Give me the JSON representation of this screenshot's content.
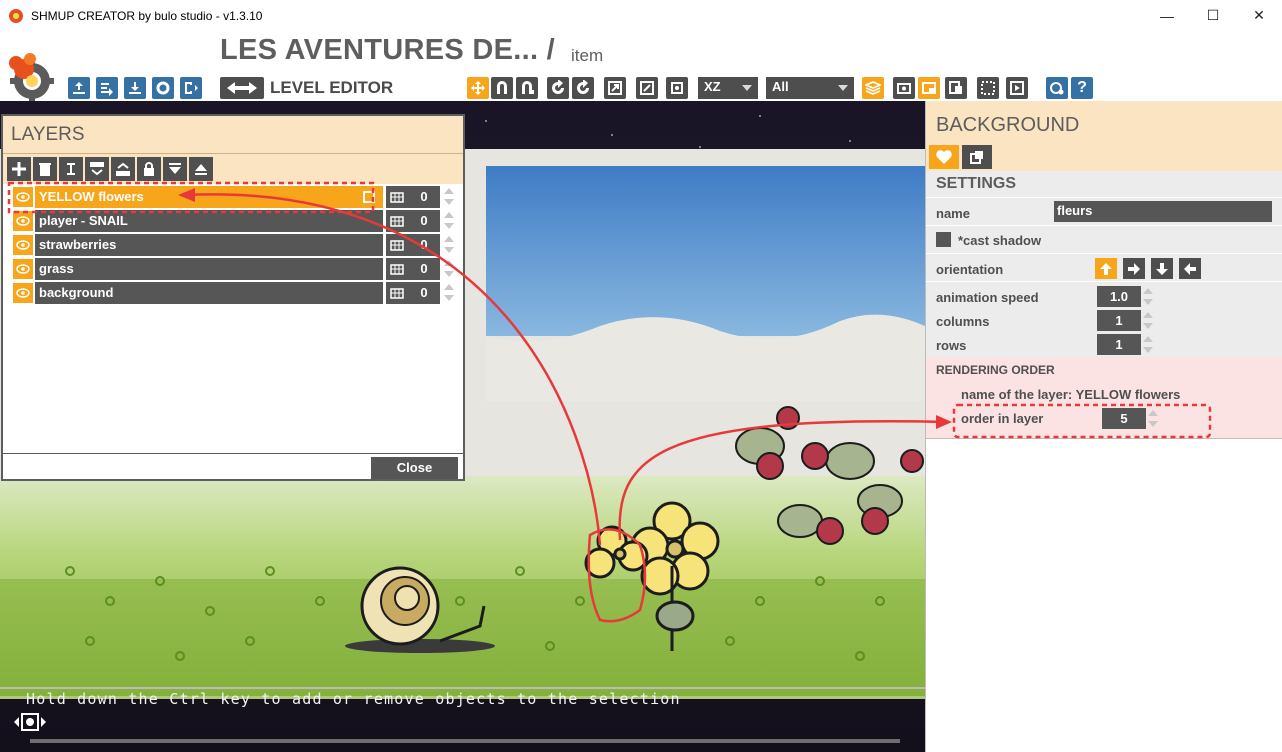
{
  "window": {
    "title": "SHMUP CREATOR by bulo studio - v1.3.10",
    "controls": [
      "minimize-icon",
      "maximize-icon",
      "close-icon"
    ]
  },
  "header": {
    "project_title": "LES AVENTURES DE... /",
    "subtitle": "item",
    "mode_label": "LEVEL EDITOR",
    "axis_select": "XZ",
    "filter_select": "All"
  },
  "scene": {
    "hint": "Hold down the Ctrl key to add or remove objects to the selection"
  },
  "layers_panel": {
    "title": "LAYERS",
    "tools": [
      "add-icon",
      "trash-icon",
      "rename-icon",
      "merge-down-icon",
      "merge-up-icon",
      "lock-icon",
      "move-down-icon",
      "move-up-icon"
    ],
    "layers": [
      {
        "name": "YELLOW flowers",
        "value": "0",
        "active": true
      },
      {
        "name": "player - SNAIL",
        "value": "0",
        "active": false
      },
      {
        "name": "strawberries",
        "value": "0",
        "active": false
      },
      {
        "name": "grass",
        "value": "0",
        "active": false
      },
      {
        "name": "background",
        "value": "0",
        "active": false
      }
    ],
    "close_label": "Close"
  },
  "right_panel": {
    "title": "BACKGROUND",
    "tabs": [
      "heart-icon",
      "layers-copy-icon"
    ],
    "settings_title": "SETTINGS",
    "name_label": "name",
    "name_value": "fleurs",
    "cast_shadow_label": "*cast shadow",
    "orientation_label": "orientation",
    "orientation_selected": "up",
    "animation_speed_label": "animation speed",
    "animation_speed_value": "1.0",
    "columns_label": "columns",
    "columns_value": "1",
    "rows_label": "rows",
    "rows_value": "1",
    "rendering_title": "RENDERING ORDER",
    "layer_name_label": "name of the layer: YELLOW flowers",
    "order_label": "order in layer",
    "order_value": "5"
  },
  "colors": {
    "accent": "#f7a51b",
    "toolbar_blue": "#3571a4",
    "dark_button": "#565656",
    "panel_header": "#fbe4c2",
    "annotation_red": "#e8393a"
  }
}
